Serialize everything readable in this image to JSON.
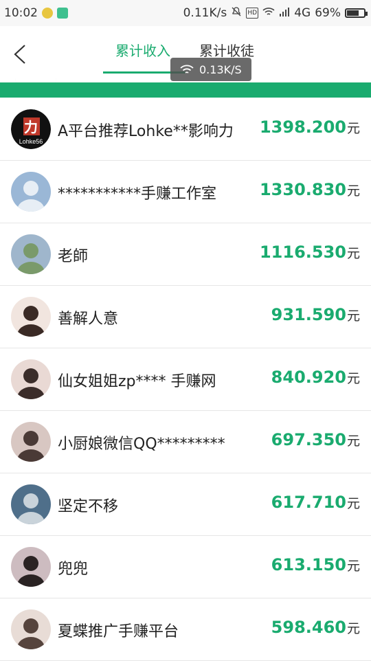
{
  "status_bar": {
    "time": "10:02",
    "net_speed": "0.11K/s",
    "network": "4G",
    "battery": "69%",
    "battery_level": 0.69
  },
  "header": {
    "tabs": [
      {
        "label": "累计收入",
        "active": true
      },
      {
        "label": "累计收徒",
        "active": false
      }
    ],
    "speed_toast": "0.13K/S"
  },
  "colors": {
    "accent": "#1aab6f",
    "text": "#222222",
    "divider": "#e6e6e6"
  },
  "currency_unit": "元",
  "ranking": [
    {
      "name": "A平台推荐Lohke**影响力",
      "amount": "1398.200",
      "avatar": "logo-avatar"
    },
    {
      "name": "***********手赚工作室",
      "amount": "1330.830",
      "avatar": "photo-avatar"
    },
    {
      "name": "老師",
      "amount": "1116.530",
      "avatar": "photo-avatar"
    },
    {
      "name": "善解人意",
      "amount": "931.590",
      "avatar": "photo-avatar"
    },
    {
      "name": "仙女姐姐zp**** 手赚网",
      "amount": "840.920",
      "avatar": "photo-avatar"
    },
    {
      "name": "小厨娘微信QQ*********",
      "amount": "697.350",
      "avatar": "photo-avatar"
    },
    {
      "name": "坚定不移",
      "amount": "617.710",
      "avatar": "photo-avatar"
    },
    {
      "name": "兜兜",
      "amount": "613.150",
      "avatar": "photo-avatar"
    },
    {
      "name": "夏蝶推广手赚平台",
      "amount": "598.460",
      "avatar": "photo-avatar"
    }
  ]
}
